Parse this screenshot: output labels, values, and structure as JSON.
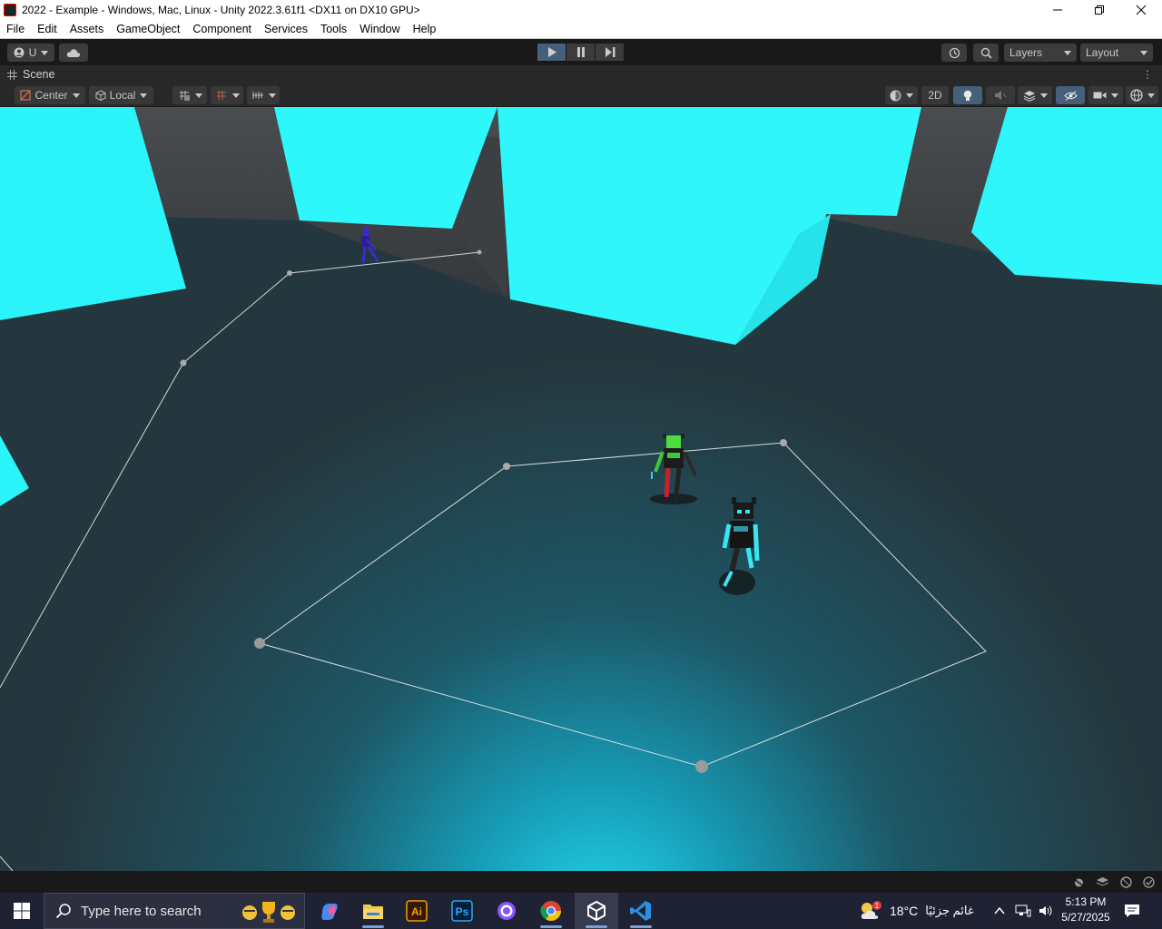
{
  "window": {
    "title": "2022 - Example - Windows, Mac, Linux - Unity 2022.3.61f1 <DX11 on DX10 GPU>",
    "controls": [
      "minimize",
      "restore",
      "close"
    ]
  },
  "menu": [
    "File",
    "Edit",
    "Assets",
    "GameObject",
    "Component",
    "Services",
    "Tools",
    "Window",
    "Help"
  ],
  "toolbar": {
    "account_label": "U",
    "layers_label": "Layers",
    "layout_label": "Layout",
    "play_state": "playing",
    "accent_color": "#46607c"
  },
  "scene": {
    "tab_label": "Scene",
    "pivot_label": "Center",
    "space_label": "Local",
    "view_2d_label": "2D"
  },
  "taskbar": {
    "search_placeholder": "Type here to search",
    "apps": [
      "copilot",
      "file-explorer",
      "illustrator",
      "photoshop",
      "github-desktop",
      "chrome",
      "unity",
      "vscode"
    ],
    "ai_label": "Ai",
    "ps_label": "Ps",
    "weather_temp": "18°C",
    "weather_text": "غائم جزئيًا",
    "weather_badge": "1",
    "time": "5:13 PM",
    "date": "5/27/2025"
  }
}
